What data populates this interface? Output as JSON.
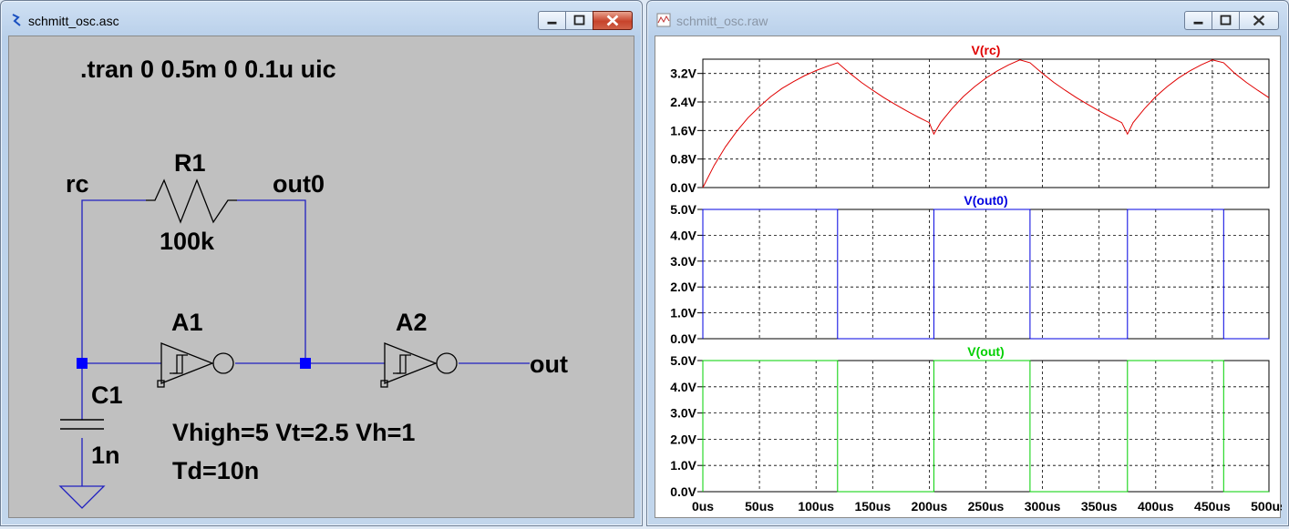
{
  "schematic_window": {
    "title": "schmitt_osc.asc",
    "sim_directive": ".tran 0 0.5m 0 0.1u uic",
    "components": {
      "R1": {
        "name": "R1",
        "value": "100k"
      },
      "C1": {
        "name": "C1",
        "value": "1n"
      },
      "A1": {
        "name": "A1"
      },
      "A2": {
        "name": "A2"
      }
    },
    "nets": {
      "rc": "rc",
      "out0": "out0",
      "out": "out"
    },
    "model_params": {
      "line1": "Vhigh=5 Vt=2.5 Vh=1",
      "line2": "Td=10n"
    }
  },
  "waveform_window": {
    "title": "schmitt_osc.raw",
    "x_tick_labels": [
      "0us",
      "50us",
      "100us",
      "150us",
      "200us",
      "250us",
      "300us",
      "350us",
      "400us",
      "450us",
      "500us"
    ]
  },
  "colors": {
    "wire": "#2020c0",
    "trace_rc": "#e00000",
    "trace_out0": "#0000e0",
    "trace_out": "#00d000",
    "sch_background": "#c0c0c0"
  },
  "chart_data": [
    {
      "type": "line",
      "title": "V(rc)",
      "series": [
        {
          "name": "V(rc)",
          "x": [
            0,
            10,
            20,
            30,
            40,
            50,
            60,
            70,
            80,
            90,
            100,
            110,
            119,
            130,
            140,
            150,
            160,
            170,
            180,
            190,
            200,
            204,
            210,
            220,
            230,
            240,
            250,
            260,
            270,
            280,
            289,
            300,
            310,
            320,
            330,
            340,
            350,
            360,
            370,
            375,
            380,
            390,
            400,
            410,
            420,
            430,
            440,
            450,
            460,
            470,
            480,
            490,
            500
          ],
          "y": [
            0,
            0.62,
            1.14,
            1.58,
            1.96,
            2.27,
            2.55,
            2.78,
            2.97,
            3.14,
            3.28,
            3.4,
            3.5,
            3.2,
            2.95,
            2.73,
            2.52,
            2.33,
            2.15,
            1.98,
            1.82,
            1.5,
            1.82,
            2.21,
            2.55,
            2.83,
            3.07,
            3.27,
            3.44,
            3.58,
            3.5,
            3.2,
            2.95,
            2.73,
            2.52,
            2.33,
            2.15,
            1.98,
            1.82,
            1.5,
            1.82,
            2.21,
            2.55,
            2.83,
            3.07,
            3.27,
            3.44,
            3.58,
            3.5,
            3.2,
            2.95,
            2.73,
            2.52
          ]
        }
      ],
      "x_range": [
        0,
        500
      ],
      "y_range": [
        0,
        3.6
      ],
      "y_tick_labels": [
        "0.0V",
        "0.8V",
        "1.6V",
        "2.4V",
        "3.2V"
      ],
      "y_ticks": [
        0,
        0.8,
        1.6,
        2.4,
        3.2
      ],
      "grid": true
    },
    {
      "type": "line",
      "title": "V(out0)",
      "series": [
        {
          "name": "V(out0)",
          "x": [
            0,
            0,
            119,
            119,
            204,
            204,
            289,
            289,
            375,
            375,
            460,
            460,
            500
          ],
          "y": [
            0,
            5,
            5,
            0,
            0,
            5,
            5,
            0,
            0,
            5,
            5,
            0,
            0
          ]
        }
      ],
      "x_range": [
        0,
        500
      ],
      "y_range": [
        0,
        5
      ],
      "y_tick_labels": [
        "0.0V",
        "1.0V",
        "2.0V",
        "3.0V",
        "4.0V",
        "5.0V"
      ],
      "y_ticks": [
        0,
        1,
        2,
        3,
        4,
        5
      ],
      "grid": true
    },
    {
      "type": "line",
      "title": "V(out)",
      "series": [
        {
          "name": "V(out)",
          "x": [
            0,
            0,
            119,
            119,
            204,
            204,
            289,
            289,
            375,
            375,
            460,
            460,
            500
          ],
          "y": [
            0,
            5,
            5,
            0,
            0,
            5,
            5,
            0,
            0,
            5,
            5,
            0,
            0
          ]
        }
      ],
      "x_range": [
        0,
        500
      ],
      "y_range": [
        0,
        5
      ],
      "y_tick_labels": [
        "0.0V",
        "1.0V",
        "2.0V",
        "3.0V",
        "4.0V",
        "5.0V"
      ],
      "y_ticks": [
        0,
        1,
        2,
        3,
        4,
        5
      ],
      "x_tick_labels": [
        "0us",
        "50us",
        "100us",
        "150us",
        "200us",
        "250us",
        "300us",
        "350us",
        "400us",
        "450us",
        "500us"
      ],
      "grid": true
    }
  ]
}
